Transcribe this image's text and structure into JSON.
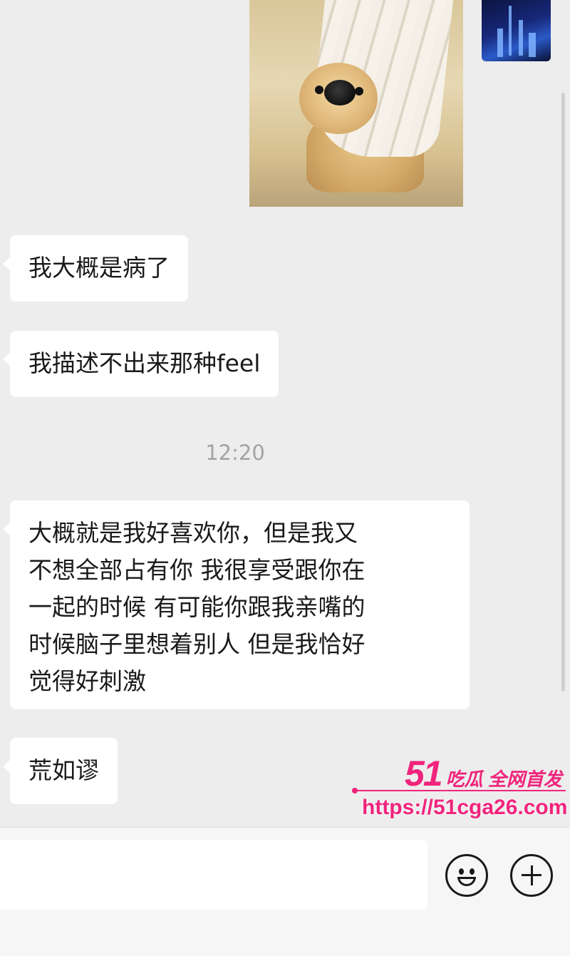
{
  "chat": {
    "messages": [
      {
        "sender": "other",
        "text": "我大概是病了"
      },
      {
        "sender": "other",
        "text": "我描述不出来那种feel"
      },
      {
        "sender": "other",
        "lines": [
          "大概就是我好喜欢你，但是我又",
          "不想全部占有你 我很享受跟你在",
          "一起的时候 有可能你跟我亲嘴的",
          "时候脑子里想着别人 但是我恰好",
          "觉得好刺激"
        ]
      },
      {
        "sender": "other",
        "text": "荒如谬"
      }
    ],
    "timestamp": "12:20"
  },
  "images": {
    "sticker": "dog-peeking-behind-curtain",
    "thumbnail": "city-night-skyline"
  },
  "watermark": {
    "number": "51",
    "slogan": "吃瓜 全网首发",
    "url": "https://51cga26.com",
    "color": "#f0247c"
  },
  "input_bar": {
    "text_value": "",
    "emoji_icon": "smiley-icon",
    "plus_icon": "plus-circle-icon"
  }
}
